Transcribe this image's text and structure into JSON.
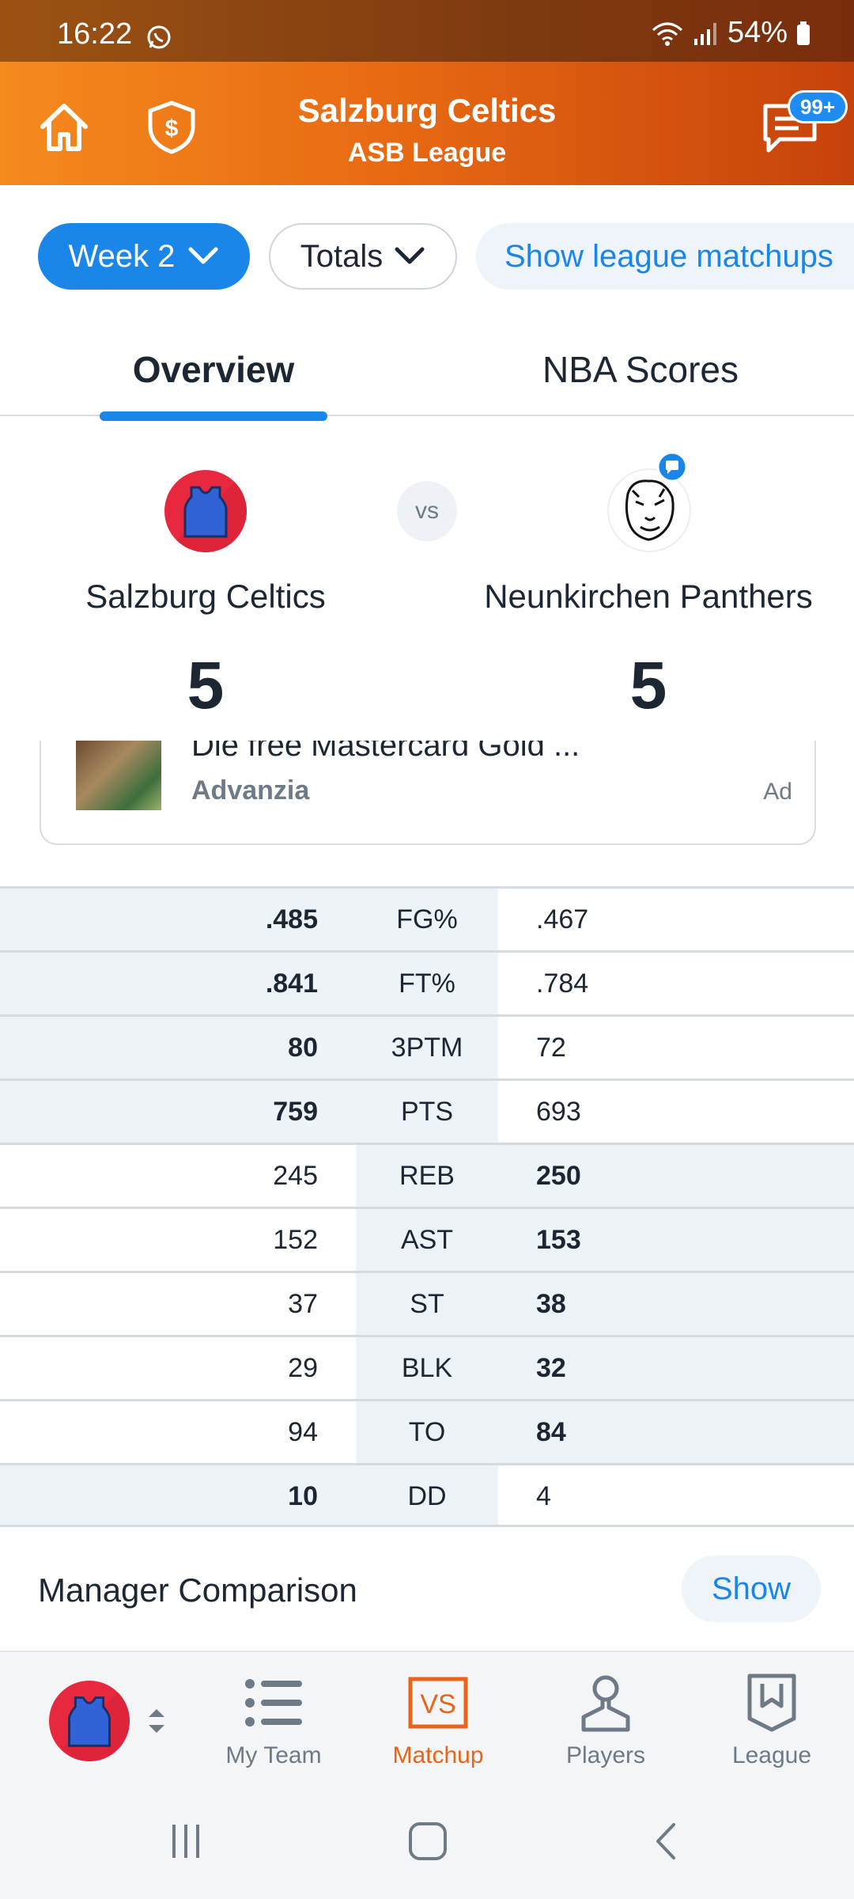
{
  "status_bar": {
    "time": "16:22",
    "battery": "54%"
  },
  "header": {
    "title": "Salzburg Celtics",
    "subtitle": "ASB League",
    "messages_badge": "99+"
  },
  "filters": {
    "week": "Week 2",
    "totals": "Totals",
    "show_matchups": "Show league matchups"
  },
  "tabs": [
    {
      "label": "Overview"
    },
    {
      "label": "NBA Scores"
    }
  ],
  "matchup": {
    "vs": "vs",
    "team1": {
      "name": "Salzburg Celtics",
      "score": "5"
    },
    "team2": {
      "name": "Neunkirchen Panthers",
      "score": "5"
    }
  },
  "ad": {
    "title": "Die free Mastercard Gold ...",
    "source": "Advanzia",
    "tag": "Ad"
  },
  "stats": [
    {
      "cat": "FG%",
      "left": ".485",
      "right": ".467",
      "winner": "left"
    },
    {
      "cat": "FT%",
      "left": ".841",
      "right": ".784",
      "winner": "left"
    },
    {
      "cat": "3PTM",
      "left": "80",
      "right": "72",
      "winner": "left"
    },
    {
      "cat": "PTS",
      "left": "759",
      "right": "693",
      "winner": "left"
    },
    {
      "cat": "REB",
      "left": "245",
      "right": "250",
      "winner": "right"
    },
    {
      "cat": "AST",
      "left": "152",
      "right": "153",
      "winner": "right"
    },
    {
      "cat": "ST",
      "left": "37",
      "right": "38",
      "winner": "right"
    },
    {
      "cat": "BLK",
      "left": "29",
      "right": "32",
      "winner": "right"
    },
    {
      "cat": "TO",
      "left": "94",
      "right": "84",
      "winner": "right"
    },
    {
      "cat": "DD",
      "left": "10",
      "right": "4",
      "winner": "left"
    }
  ],
  "manager_comparison": {
    "title": "Manager Comparison",
    "button": "Show"
  },
  "bottom_nav": [
    {
      "label": "My Team",
      "icon": "list-icon"
    },
    {
      "label": "Matchup",
      "icon": "vs-icon",
      "active": true
    },
    {
      "label": "Players",
      "icon": "person-icon"
    },
    {
      "label": "League",
      "icon": "bookmark-shield-icon"
    }
  ],
  "colors": {
    "accent": "#1b86e9",
    "brand_orange": "#e86a13",
    "team_red": "#e8283e",
    "jersey_blue": "#2f63d6"
  }
}
